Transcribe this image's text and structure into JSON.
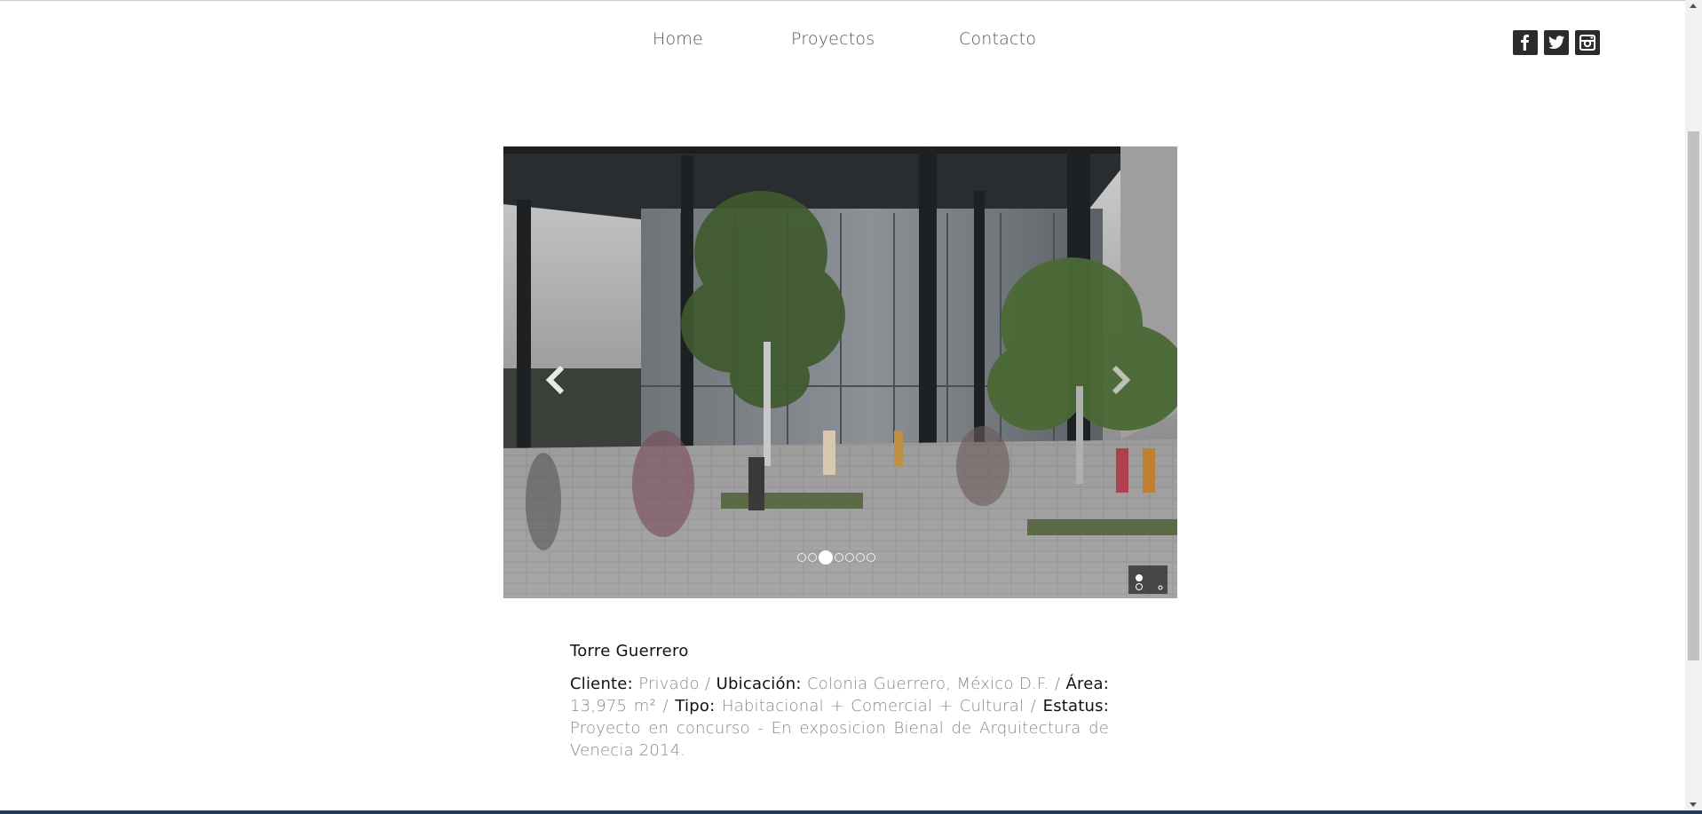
{
  "nav": {
    "items": [
      {
        "label": "Home"
      },
      {
        "label": "Proyectos"
      },
      {
        "label": "Contacto"
      }
    ]
  },
  "social": {
    "icons": [
      "facebook-icon",
      "twitter-icon",
      "instagram-icon"
    ]
  },
  "slider": {
    "dots_total": 7,
    "active_dot_index": 2
  },
  "project": {
    "title": "Torre Guerrero",
    "details": [
      {
        "key": "Cliente:",
        "value": "Privado"
      },
      {
        "key": "Ubicación:",
        "value": "Colonia Guerrero, México D.F."
      },
      {
        "key": "Área:",
        "value": "13,975 m²"
      },
      {
        "key": "Tipo:",
        "value": "Habitacional + Comercial + Cultural"
      },
      {
        "key": "Estatus:",
        "value": "Proyecto en concurso - En exposicion Bienal de Arquitectura de Venecia 2014."
      }
    ]
  },
  "colors": {
    "text_dark": "#111111",
    "text_muted": "#888888",
    "social_bg": "#2b2b2b"
  }
}
